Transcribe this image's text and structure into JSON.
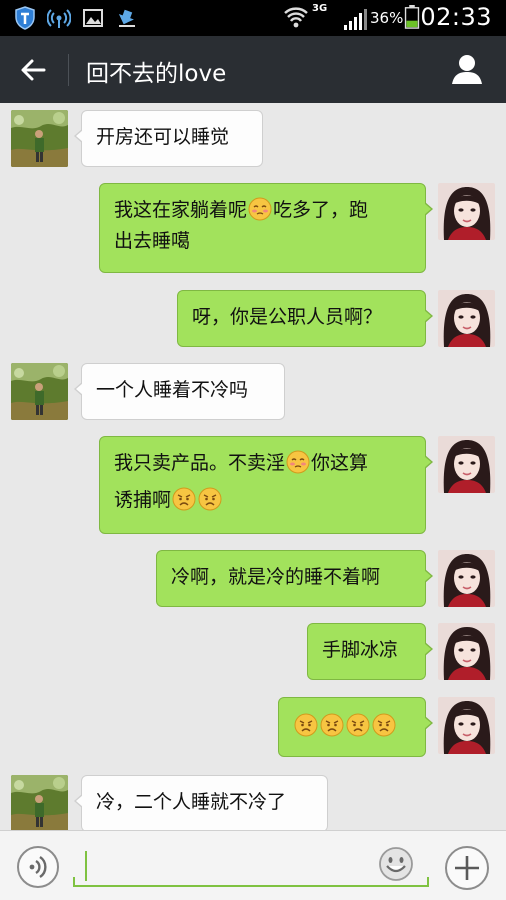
{
  "status_bar": {
    "time": "02:33",
    "battery_percent": "36%",
    "network": "3G",
    "battery_level": 0.36
  },
  "header": {
    "title": "回不去的love",
    "back_icon": "back-arrow-icon",
    "profile_icon": "person-icon"
  },
  "colors": {
    "outgoing_bubble": "#a2e25c",
    "incoming_bubble": "#fdfdfd",
    "header_bg": "#2a2e33",
    "chat_bg": "#e8e8e8"
  },
  "messages": [
    {
      "sender": "other",
      "parts": [
        "开房还可以睡觉"
      ]
    },
    {
      "sender": "me",
      "line1": [
        "我这在家躺着呢",
        ":blush:",
        "吃多了，跑"
      ],
      "line2": [
        "出去睡噶"
      ]
    },
    {
      "sender": "me",
      "parts": [
        "呀，你是公职人员啊？"
      ]
    },
    {
      "sender": "other",
      "parts": [
        "一个人睡着不冷吗"
      ]
    },
    {
      "sender": "me",
      "line1": [
        "我只卖产品。不卖淫",
        ":blush:",
        "你这算"
      ],
      "line2": [
        "诱捕啊",
        ":sad:",
        ":sad:"
      ]
    },
    {
      "sender": "me",
      "parts": [
        "冷啊，就是冷的睡不着啊"
      ]
    },
    {
      "sender": "me",
      "parts": [
        "手脚冰凉"
      ]
    },
    {
      "sender": "me",
      "parts": [
        ":sad:",
        ":sad:",
        ":sad:",
        ":sad:"
      ]
    },
    {
      "sender": "other",
      "parts": [
        "冷，二个人睡就不冷了"
      ]
    }
  ],
  "text": {
    "m0": "开房还可以睡觉",
    "m1a": "我这在家躺着呢",
    "m1b": "吃多了，跑",
    "m1c": "出去睡噶",
    "m2": "呀，你是公职人员啊？",
    "m3": "一个人睡着不冷吗",
    "m4a": "我只卖产品。不卖淫",
    "m4b": "你这算",
    "m4c": "诱捕啊",
    "m5": "冷啊，就是冷的睡不着啊",
    "m6": "手脚冰凉",
    "m8": "冷，二个人睡就不冷了"
  },
  "input_bar": {
    "voice_icon": "voice-icon",
    "emoji_icon": "smiley-icon",
    "plus_icon": "plus-icon",
    "value": ""
  }
}
